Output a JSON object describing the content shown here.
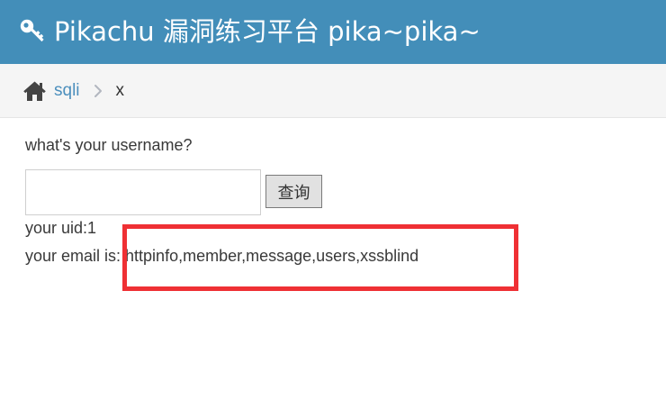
{
  "header": {
    "title": "Pikachu 漏洞练习平台 pika~pika~",
    "icon": "key-icon",
    "background_color": "#438eb9"
  },
  "breadcrumb": {
    "home_icon": "home-icon",
    "items": [
      {
        "label": "sqli"
      },
      {
        "label": "x"
      }
    ],
    "separator_icon": "chevron-right-icon"
  },
  "form": {
    "prompt": "what's your username?",
    "username_value": "",
    "username_placeholder": "",
    "query_button_label": "查询"
  },
  "result": {
    "uid_text": "your uid:1",
    "email_text": "your email is: httpinfo,member,message,users,xssblind"
  },
  "annotation": {
    "highlight_color": "#ef3034"
  }
}
